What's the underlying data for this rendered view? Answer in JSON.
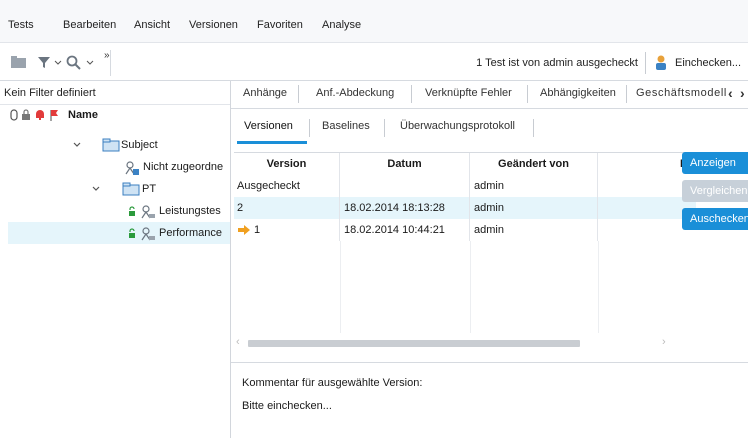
{
  "menu": [
    "Tests",
    "Bearbeiten",
    "Ansicht",
    "Versionen",
    "Favoriten",
    "Analyse"
  ],
  "toolbar": {
    "status_text": "1 Test ist von admin ausgecheckt",
    "checkin_label": "Einchecken..."
  },
  "tree": {
    "filter_text": "Kein Filter definiert",
    "column_name": "Name",
    "nodes": [
      {
        "label": "Subject"
      },
      {
        "label": "Nicht zugeordne"
      },
      {
        "label": "PT"
      },
      {
        "label": "Leistungstes"
      },
      {
        "label": "Performance"
      }
    ]
  },
  "detail_tabs": [
    "Anhänge",
    "Anf.-Abdeckung",
    "Verknüpfte Fehler",
    "Abhängigkeiten",
    "Geschäftsmodell"
  ],
  "sub_tabs": [
    "Versionen",
    "Baselines",
    "Überwachungsprotokoll"
  ],
  "grid": {
    "columns": [
      "Version",
      "Datum",
      "Geändert von",
      "Ba"
    ],
    "rows": [
      {
        "version": "Ausgecheckt",
        "datum": "",
        "geaendert_von": "admin"
      },
      {
        "version": "2",
        "datum": "18.02.2014 18:13:28",
        "geaendert_von": "admin"
      },
      {
        "version": "1",
        "datum": "18.02.2014 10:44:21",
        "geaendert_von": "admin"
      }
    ]
  },
  "buttons": {
    "view": "Anzeigen",
    "compare": "Vergleichen",
    "checkout": "Auschecken"
  },
  "comment": {
    "label": "Kommentar für ausgewählte Version:",
    "text": "Bitte einchecken..."
  },
  "colors": {
    "accent": "#1a8fd8",
    "disabled": "#c7d0d9",
    "selection": "#e5f5fb"
  }
}
